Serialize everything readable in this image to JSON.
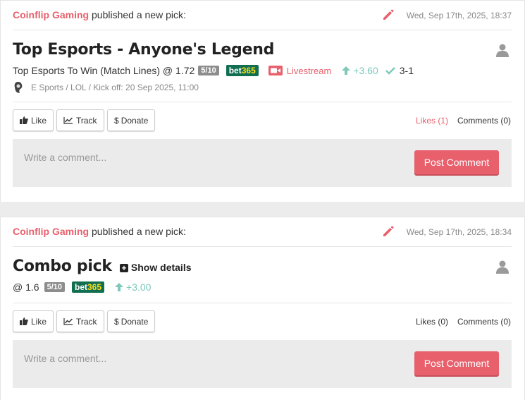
{
  "posts": [
    {
      "author": "Coinflip Gaming",
      "action": " published a new pick:",
      "date": "Wed, Sep 17th, 2025, 18:37",
      "title": "Top Esports - Anyone's Legend",
      "pick": "Top Esports To Win (Match Lines) @ 1.72",
      "confidence": "5/10",
      "bookmaker_a": "bet",
      "bookmaker_b": "365",
      "livestream": "Livestream",
      "profit": "+3.60",
      "result": "3-1",
      "meta": "E Sports / LOL / Kick off: 20 Sep 2025, 11:00",
      "like": "Like",
      "track": "Track",
      "donate": "Donate",
      "likes": "Likes (1)",
      "comments": "Comments (0)",
      "comment_placeholder": "Write a comment...",
      "post_comment": "Post Comment"
    },
    {
      "author": "Coinflip Gaming",
      "action": " published a new pick:",
      "date": "Wed, Sep 17th, 2025, 18:34",
      "title": "Combo pick",
      "show_details": "Show details",
      "pick": "@ 1.6",
      "confidence": "5/10",
      "bookmaker_a": "bet",
      "bookmaker_b": "365",
      "profit": "+3.00",
      "like": "Like",
      "track": "Track",
      "donate": "Donate",
      "likes": "Likes (0)",
      "comments": "Comments (0)",
      "comment_placeholder": "Write a comment...",
      "post_comment": "Post Comment"
    }
  ],
  "colors": {
    "accent": "#e8606c",
    "profit": "#7cc9ba",
    "bet365_bg": "#126e51",
    "bet365_yellow": "#ffdf1b",
    "badge": "#8d8d8d"
  },
  "icons": [
    "pencil-icon",
    "user-icon",
    "camera-icon",
    "arrow-up-icon",
    "check-icon",
    "game-icon",
    "thumbs-up-icon",
    "chart-line-icon",
    "dollar-icon",
    "plus-icon"
  ]
}
